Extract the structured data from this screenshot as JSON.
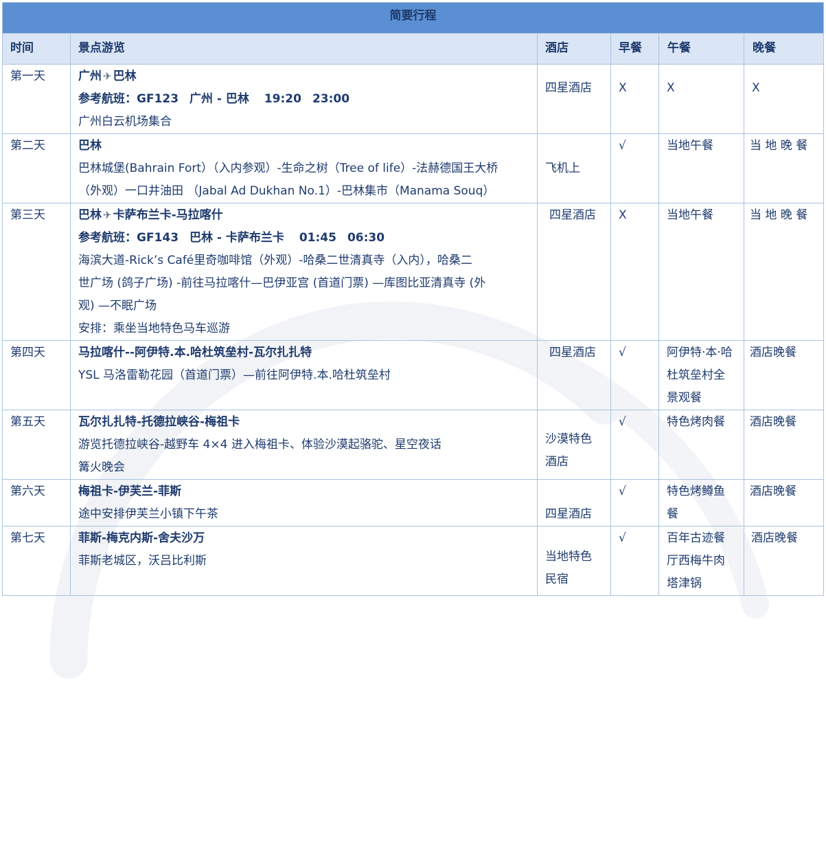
{
  "title": "简要行程",
  "headers": {
    "day": "时间",
    "sights": "景点游览",
    "hotel": "酒店",
    "breakfast": "早餐",
    "lunch": "午餐",
    "dinner": "晚餐"
  },
  "icons": {
    "plane": "airplane-icon"
  },
  "colors": {
    "title_bg": "#5b8fd3",
    "header_bg": "#dae6f5",
    "border": "#a9c2e2",
    "text": "#1f3b6e"
  },
  "rows": [
    {
      "day": "第一天",
      "route_from": "广州",
      "route_to": "巴林",
      "flight_label": "参考航班：GF123",
      "flight_from": "广州",
      "flight_sep": "-",
      "flight_to": "巴林",
      "flight_dep": "19:20",
      "flight_arr": "23:00",
      "desc": [
        "广州白云机场集合"
      ],
      "hotel": "四星酒店",
      "breakfast": "X",
      "lunch": "X",
      "dinner": "X"
    },
    {
      "day": "第二天",
      "route": "巴林",
      "desc": [
        "巴林城堡(Bahrain Fort）（入内参观）-生命之树（Tree of life）-法赫德国王大桥",
        "（外观）一口井油田 （Jabal Ad Dukhan No.1）-巴林集市（Manama Souq）"
      ],
      "hotel": "飞机上",
      "breakfast": "√",
      "lunch": "当地午餐",
      "dinner": "当 地 晚 餐"
    },
    {
      "day": "第三天",
      "route_from": "巴林",
      "route_to": "卡萨布兰卡-马拉喀什",
      "flight_label": "参考航班：GF143",
      "flight_from": "巴林",
      "flight_sep": "-",
      "flight_to": "卡萨布兰卡",
      "flight_dep": "01:45",
      "flight_arr": "06:30",
      "desc": [
        "海滨大道-Rick’s Café里奇咖啡馆（外观）-哈桑二世清真寺（入内），哈桑二",
        "世广场 (鸽子广场) -前往马拉喀什—巴伊亚宫 (首道门票) —库图比亚清真寺 (外",
        "观) —不眠广场",
        "安排：乘坐当地特色马车巡游"
      ],
      "hotel": "四星酒店",
      "breakfast": "X",
      "lunch": "当地午餐",
      "dinner": "当 地 晚 餐"
    },
    {
      "day": "第四天",
      "route": "马拉喀什--阿伊特.本.哈杜筑垒村-瓦尔扎扎特",
      "desc": [
        "YSL 马洛雷勒花园（首道门票）—前往阿伊特.本.哈杜筑垒村"
      ],
      "hotel": "四星酒店",
      "breakfast": "√",
      "lunch_lines": [
        "阿伊特·本·哈",
        "杜筑垒村全",
        "景观餐"
      ],
      "dinner": "酒店晚餐"
    },
    {
      "day": "第五天",
      "route": "瓦尔扎扎特-托德拉峡谷-梅祖卡",
      "desc": [
        "游览托德拉峡谷-越野车 4×4 进入梅祖卡、体验沙漠起骆驼、星空夜话",
        "篝火晚会"
      ],
      "hotel_lines": [
        "沙漠特色",
        "酒店"
      ],
      "breakfast": "√",
      "lunch": "特色烤肉餐",
      "dinner": "酒店晚餐"
    },
    {
      "day": "第六天",
      "route": "梅祖卡-伊芙兰-菲斯",
      "desc": [
        "途中安排伊芙兰小镇下午茶"
      ],
      "hotel": "四星酒店",
      "breakfast": "√",
      "lunch_lines": [
        "特色烤鳟鱼",
        "餐"
      ],
      "dinner": "酒店晚餐"
    },
    {
      "day": "第七天",
      "route": "菲斯-梅克内斯-舍夫沙万",
      "desc": [
        "菲斯老城区，沃吕比利斯"
      ],
      "hotel_lines": [
        "当地特色",
        "民宿"
      ],
      "breakfast": "√",
      "lunch_lines": [
        "百年古迹餐",
        "厅西梅牛肉",
        "塔津锅"
      ],
      "dinner": "酒店晚餐"
    }
  ]
}
